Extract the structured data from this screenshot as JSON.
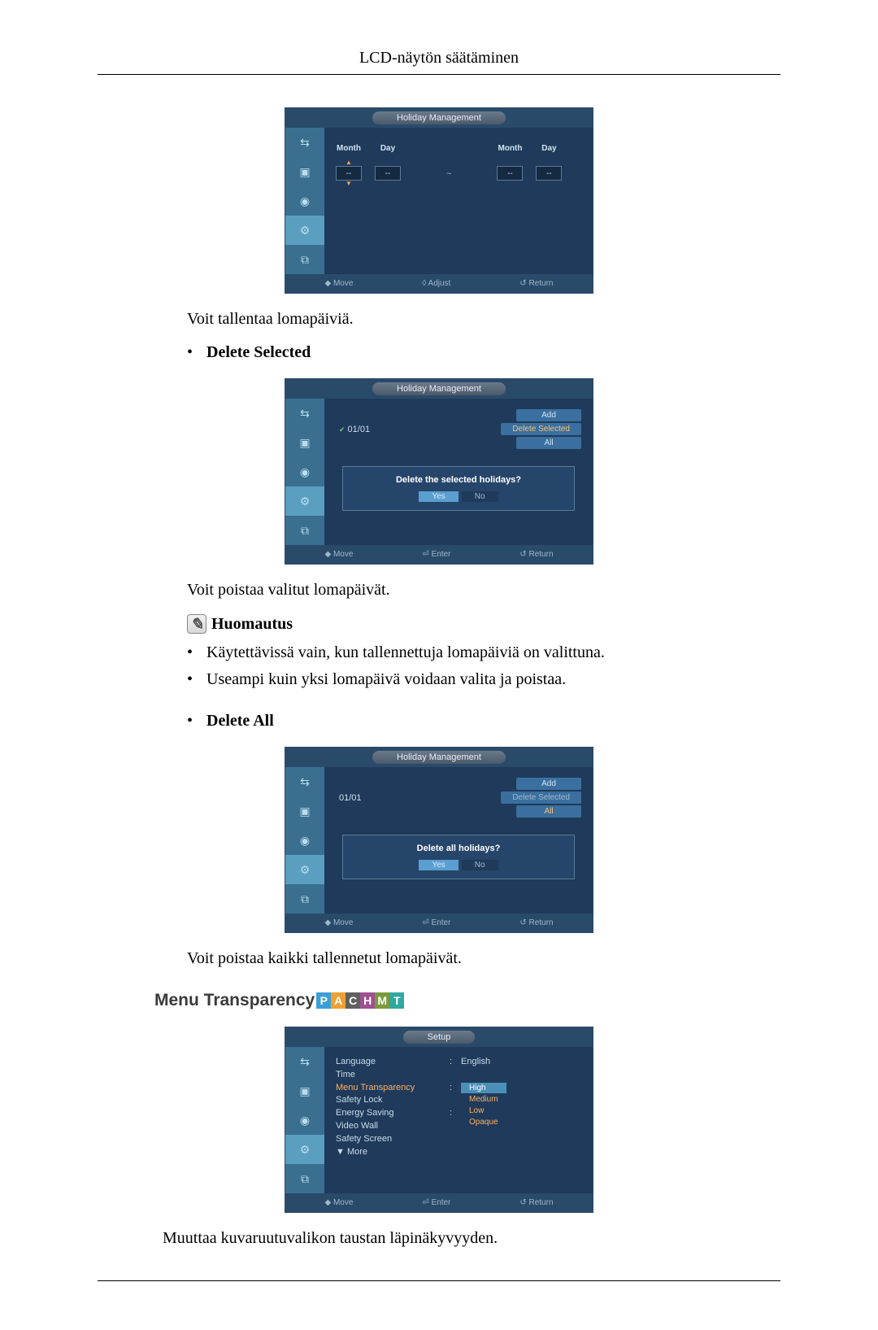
{
  "header": {
    "title": "LCD-näytön säätäminen"
  },
  "holiday1": {
    "title": "Holiday Management",
    "cols": [
      {
        "month": "Month",
        "day": "Day",
        "mval": "--",
        "dval": "--"
      },
      {
        "month": "Month",
        "day": "Day",
        "mval": "--",
        "dval": "--"
      }
    ],
    "footer": {
      "move": "◆ Move",
      "adjust": "◊ Adjust",
      "ret": "↺ Return"
    }
  },
  "text_after_h1": "Voit tallentaa lomapäiviä.",
  "delete_selected": {
    "label": "Delete Selected"
  },
  "holiday2": {
    "title": "Holiday Management",
    "entry": "01/01",
    "buttons": {
      "add": "Add",
      "delsel": "Delete Selected",
      "all": "All"
    },
    "dialog": {
      "q": "Delete the selected holidays?",
      "yes": "Yes",
      "no": "No"
    },
    "footer": {
      "move": "◆ Move",
      "enter": "⏎ Enter",
      "ret": "↺ Return"
    }
  },
  "text_after_h2": "Voit poistaa valitut lomapäivät.",
  "note_label": "Huomautus",
  "note_items": [
    "Käytettävissä vain, kun tallennettuja lomapäiviä on valittuna.",
    "Useampi kuin yksi lomapäivä voidaan valita ja poistaa."
  ],
  "delete_all": {
    "label": "Delete All"
  },
  "holiday3": {
    "title": "Holiday Management",
    "entry": "01/01",
    "buttons": {
      "add": "Add",
      "delsel": "Delete Selected",
      "all": "All"
    },
    "dialog": {
      "q": "Delete all holidays?",
      "yes": "Yes",
      "no": "No"
    },
    "footer": {
      "move": "◆ Move",
      "enter": "⏎ Enter",
      "ret": "↺ Return"
    }
  },
  "text_after_h3": "Voit poistaa kaikki tallennetut lomapäivät.",
  "menu_transparency": {
    "heading": "Menu Transparency",
    "badges": [
      "P",
      "A",
      "C",
      "H",
      "M",
      "T"
    ]
  },
  "setup": {
    "title": "Setup",
    "rows": {
      "language": {
        "label": "Language",
        "val": "English"
      },
      "time": {
        "label": "Time"
      },
      "transparency": {
        "label": "Menu Transparency",
        "opts": [
          "High",
          "Medium",
          "Low",
          "Opaque"
        ],
        "selected": "High"
      },
      "safety_lock": {
        "label": "Safety Lock"
      },
      "energy_saving": {
        "label": "Energy Saving"
      },
      "video_wall": {
        "label": "Video Wall"
      },
      "safety_screen": {
        "label": "Safety Screen"
      }
    },
    "more": "▼ More",
    "footer": {
      "move": "◆ Move",
      "enter": "⏎ Enter",
      "ret": "↺ Return"
    }
  },
  "text_after_setup": "Muuttaa kuvaruutuvalikon taustan läpinäkyvyyden."
}
